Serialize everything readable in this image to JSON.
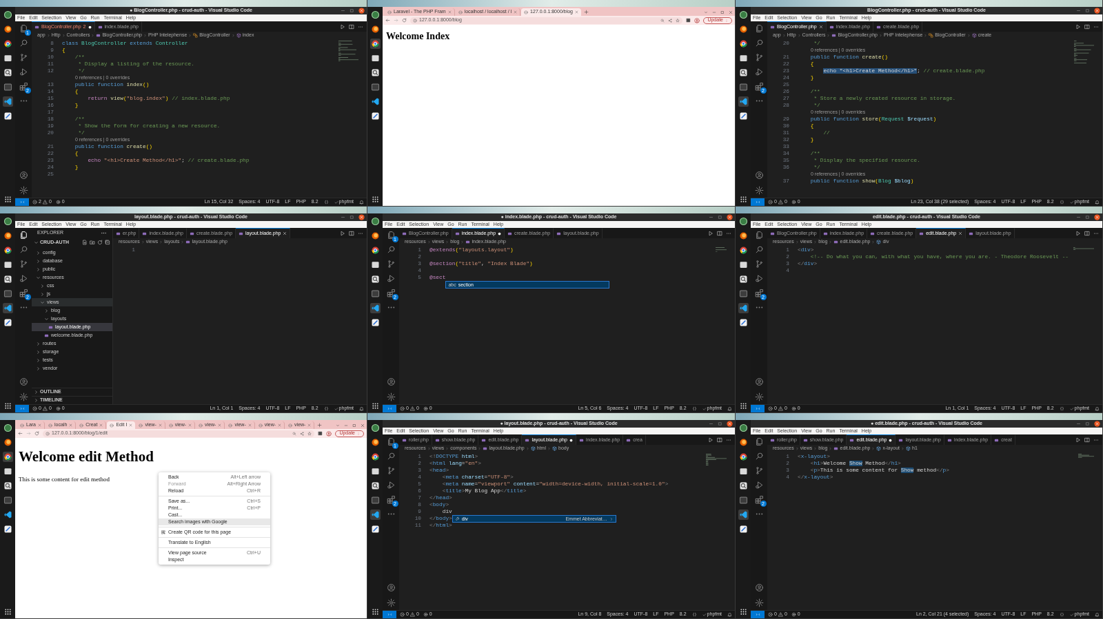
{
  "panels": [
    {
      "kind": "vscode",
      "title": "● BlogController.php - crud-auth - Visual Studio Code",
      "menu": [
        "File",
        "Edit",
        "Selection",
        "View",
        "Go",
        "Run",
        "Terminal",
        "Help"
      ],
      "badges": {
        "files": "1",
        "extensions": "2"
      },
      "tabs": [
        {
          "label": "BlogController.php",
          "problems": "2",
          "selected": true,
          "modified": true
        },
        {
          "label": "index.blade.php",
          "selected": false,
          "modified": false
        }
      ],
      "breadcrumb": [
        {
          "text": "app",
          "kind": "folder"
        },
        {
          "text": "Http",
          "kind": "folder"
        },
        {
          "text": "Controllers",
          "kind": "folder"
        },
        {
          "text": "BlogController.php",
          "kind": "file"
        },
        {
          "text": "PHP Intelephense",
          "kind": "provider"
        },
        {
          "text": "BlogController",
          "kind": "class"
        },
        {
          "text": "index",
          "kind": "method"
        }
      ],
      "lines": [
        {
          "kind": "code",
          "num": "8",
          "tokens": [
            {
              "text": "class",
              "kind": "keyword"
            },
            {
              "text": " BlogController ",
              "kind": "type"
            },
            {
              "text": "extends",
              "kind": "keyword"
            },
            {
              "text": " Controller",
              "kind": "type"
            }
          ]
        },
        {
          "kind": "code",
          "num": "9",
          "tokens": [
            {
              "text": "{",
              "kind": "bracket"
            }
          ]
        },
        {
          "kind": "code",
          "num": "10",
          "tokens": [
            {
              "text": "    /**",
              "kind": "comment"
            }
          ]
        },
        {
          "kind": "code",
          "num": "11",
          "tokens": [
            {
              "text": "     * Display a listing of the resource.",
              "kind": "comment"
            }
          ]
        },
        {
          "kind": "code",
          "num": "12",
          "tokens": [
            {
              "text": "     */",
              "kind": "comment"
            }
          ]
        },
        {
          "kind": "lens",
          "text": "0 references | 0 overrides"
        },
        {
          "kind": "code",
          "num": "13",
          "tokens": [
            {
              "text": "    public function ",
              "kind": "keyword"
            },
            {
              "text": "index",
              "kind": "function"
            },
            {
              "text": "()",
              "kind": "bracket"
            }
          ]
        },
        {
          "kind": "code",
          "num": "14",
          "tokens": [
            {
              "text": "    {",
              "kind": "bracket"
            }
          ]
        },
        {
          "kind": "code",
          "num": "15",
          "tokens": [
            {
              "text": "        return",
              "kind": "control"
            },
            {
              "text": " view",
              "kind": "function"
            },
            {
              "text": "(",
              "kind": "bracket"
            },
            {
              "text": "\"blog.index\"",
              "kind": "string"
            },
            {
              "text": ")",
              "kind": "bracket"
            },
            {
              "text": " // index.blade.php",
              "kind": "comment"
            }
          ]
        },
        {
          "kind": "code",
          "num": "16",
          "tokens": [
            {
              "text": "    }",
              "kind": "bracket"
            }
          ]
        },
        {
          "kind": "code",
          "num": "17"
        },
        {
          "kind": "code",
          "num": "18",
          "tokens": [
            {
              "text": "    /**",
              "kind": "comment"
            }
          ]
        },
        {
          "kind": "code",
          "num": "19",
          "tokens": [
            {
              "text": "     * Show the form for creating a new resource.",
              "kind": "comment"
            }
          ]
        },
        {
          "kind": "code",
          "num": "20",
          "tokens": [
            {
              "text": "     */",
              "kind": "comment"
            }
          ]
        },
        {
          "kind": "lens",
          "text": "0 references | 0 overrides"
        },
        {
          "kind": "code",
          "num": "21",
          "tokens": [
            {
              "text": "    public function ",
              "kind": "keyword"
            },
            {
              "text": "create",
              "kind": "function"
            },
            {
              "text": "()",
              "kind": "bracket"
            }
          ]
        },
        {
          "kind": "code",
          "num": "22",
          "tokens": [
            {
              "text": "    {",
              "kind": "bracket"
            }
          ]
        },
        {
          "kind": "code",
          "num": "23",
          "tokens": [
            {
              "text": "        echo",
              "kind": "control"
            },
            {
              "text": " \"<h1>Create Method</h1>\"",
              "kind": "string"
            },
            {
              "text": ";",
              "kind": "plain"
            },
            {
              "text": " // create.blade.php",
              "kind": "comment"
            }
          ]
        },
        {
          "kind": "code",
          "num": "24",
          "tokens": [
            {
              "text": "    }",
              "kind": "bracket"
            }
          ]
        },
        {
          "kind": "code",
          "num": "25"
        }
      ],
      "status": {
        "errors": "2",
        "warnings": "0",
        "ports": "0",
        "items": [
          "Ln 15, Col 32",
          "Spaces: 4",
          "UTF-8",
          "LF",
          "PHP",
          "8.2",
          "phpfmt"
        ]
      }
    },
    {
      "kind": "browser",
      "tabs": [
        {
          "label": "Laravel - The PHP Fram",
          "selected": false
        },
        {
          "label": "localhost / localhost / l",
          "selected": false
        },
        {
          "label": "127.0.0.1:8000/blog",
          "selected": true
        }
      ],
      "address": "127.0.0.1:8000/blog",
      "update_button": "Update",
      "page": {
        "kind": "compact",
        "heading": "Welcome Index"
      }
    },
    {
      "kind": "vscode",
      "title": "BlogController.php - crud-auth - Visual Studio Code",
      "menu": [
        "File",
        "Edit",
        "Selection",
        "View",
        "Go",
        "Run",
        "Terminal",
        "Help"
      ],
      "badges": {
        "extensions": "2"
      },
      "tabs": [
        {
          "label": "BlogController.php",
          "selected": true,
          "modified": false
        },
        {
          "label": "index.blade.php",
          "selected": false,
          "modified": false
        },
        {
          "label": "create.blade.php",
          "selected": false,
          "modified": false
        }
      ],
      "breadcrumb": [
        {
          "text": "app",
          "kind": "folder"
        },
        {
          "text": "Http",
          "kind": "folder"
        },
        {
          "text": "Controllers",
          "kind": "folder"
        },
        {
          "text": "BlogController.php",
          "kind": "file"
        },
        {
          "text": "PHP Intelephense",
          "kind": "provider"
        },
        {
          "text": "BlogController",
          "kind": "class"
        },
        {
          "text": "create",
          "kind": "method"
        }
      ],
      "lines": [
        {
          "kind": "code",
          "num": "20",
          "tokens": [
            {
              "text": "     */",
              "kind": "comment"
            }
          ]
        },
        {
          "kind": "lens",
          "text": "0 references | 0 overrides"
        },
        {
          "kind": "code",
          "num": "21",
          "tokens": [
            {
              "text": "    public function ",
              "kind": "keyword"
            },
            {
              "text": "create",
              "kind": "function"
            },
            {
              "text": "()",
              "kind": "bracket"
            }
          ]
        },
        {
          "kind": "code",
          "num": "22",
          "tokens": [
            {
              "text": "    {",
              "kind": "bracket"
            }
          ]
        },
        {
          "kind": "code",
          "num": "23",
          "tokens": [
            {
              "text": "        echo \"<h1>Create Method</h1>\"",
              "kind": "selection"
            },
            {
              "text": ";",
              "kind": "plain"
            },
            {
              "text": " // create.blade.php",
              "kind": "comment"
            }
          ]
        },
        {
          "kind": "code",
          "num": "24",
          "tokens": [
            {
              "text": "    }",
              "kind": "bracket"
            }
          ]
        },
        {
          "kind": "code",
          "num": "25"
        },
        {
          "kind": "code",
          "num": "26",
          "tokens": [
            {
              "text": "    /**",
              "kind": "comment"
            }
          ]
        },
        {
          "kind": "code",
          "num": "27",
          "tokens": [
            {
              "text": "     * Store a newly created resource in storage.",
              "kind": "comment"
            }
          ]
        },
        {
          "kind": "code",
          "num": "28",
          "tokens": [
            {
              "text": "     */",
              "kind": "comment"
            }
          ]
        },
        {
          "kind": "lens",
          "text": "0 references | 0 overrides"
        },
        {
          "kind": "code",
          "num": "29",
          "tokens": [
            {
              "text": "    public function ",
              "kind": "keyword"
            },
            {
              "text": "store",
              "kind": "function"
            },
            {
              "text": "(",
              "kind": "bracket"
            },
            {
              "text": "Request",
              "kind": "type"
            },
            {
              "text": " $request",
              "kind": "variable"
            },
            {
              "text": ")",
              "kind": "bracket"
            }
          ]
        },
        {
          "kind": "code",
          "num": "30",
          "tokens": [
            {
              "text": "    {",
              "kind": "bracket"
            }
          ]
        },
        {
          "kind": "code",
          "num": "31",
          "tokens": [
            {
              "text": "        //",
              "kind": "comment"
            }
          ]
        },
        {
          "kind": "code",
          "num": "32",
          "tokens": [
            {
              "text": "    }",
              "kind": "bracket"
            }
          ]
        },
        {
          "kind": "code",
          "num": "33"
        },
        {
          "kind": "code",
          "num": "34",
          "tokens": [
            {
              "text": "    /**",
              "kind": "comment"
            }
          ]
        },
        {
          "kind": "code",
          "num": "35",
          "tokens": [
            {
              "text": "     * Display the specified resource.",
              "kind": "comment"
            }
          ]
        },
        {
          "kind": "code",
          "num": "36",
          "tokens": [
            {
              "text": "     */",
              "kind": "comment"
            }
          ]
        },
        {
          "kind": "lens",
          "text": "0 references | 0 overrides"
        },
        {
          "kind": "code",
          "num": "37",
          "tokens": [
            {
              "text": "    public function ",
              "kind": "keyword"
            },
            {
              "text": "show",
              "kind": "function"
            },
            {
              "text": "(",
              "kind": "bracket"
            },
            {
              "text": "Blog",
              "kind": "type"
            },
            {
              "text": " $blog",
              "kind": "variable"
            },
            {
              "text": ")",
              "kind": "bracket"
            }
          ]
        }
      ],
      "status": {
        "errors": "0",
        "warnings": "0",
        "ports": "0",
        "items": [
          "Ln 23, Col 38 (29 selected)",
          "Spaces: 4",
          "UTF-8",
          "LF",
          "PHP",
          "8.2",
          "phpfmt"
        ]
      }
    },
    {
      "kind": "vscode",
      "title": "layout.blade.php - crud-auth - Visual Studio Code",
      "menu": [
        "File",
        "Edit",
        "Selection",
        "View",
        "Go",
        "Run",
        "Terminal",
        "Help"
      ],
      "badges": {
        "extensions": "2"
      },
      "sidebar": {
        "title": "EXPLORER",
        "root": "CRUD-AUTH",
        "tree": [
          {
            "label": "config",
            "kind": "folder",
            "expanded": false,
            "selected": false,
            "hovered": false
          },
          {
            "label": "database",
            "kind": "folder",
            "expanded": false,
            "selected": false,
            "hovered": false
          },
          {
            "label": "public",
            "kind": "folder",
            "expanded": false,
            "selected": false,
            "hovered": false
          },
          {
            "label": "resources",
            "kind": "folder",
            "expanded": true,
            "selected": false,
            "hovered": false,
            "children": [
              {
                "label": "css",
                "kind": "folder",
                "expanded": false,
                "selected": false,
                "hovered": false
              },
              {
                "label": "js",
                "kind": "folder",
                "expanded": false,
                "selected": false,
                "hovered": false
              },
              {
                "label": "views",
                "kind": "folder",
                "expanded": true,
                "selected": false,
                "hovered": true,
                "children": [
                  {
                    "label": "blog",
                    "kind": "folder",
                    "expanded": false,
                    "selected": false,
                    "hovered": false
                  },
                  {
                    "label": "layouts",
                    "kind": "folder",
                    "expanded": true,
                    "selected": false,
                    "hovered": false,
                    "children": [
                      {
                        "label": "layout.blade.php",
                        "kind": "file",
                        "selected": true,
                        "hovered": false
                      }
                    ]
                  },
                  {
                    "label": "welcome.blade.php",
                    "kind": "file",
                    "selected": false,
                    "hovered": false
                  }
                ]
              }
            ]
          },
          {
            "label": "routes",
            "kind": "folder",
            "expanded": false,
            "selected": false,
            "hovered": false
          },
          {
            "label": "storage",
            "kind": "folder",
            "expanded": false,
            "selected": false,
            "hovered": false
          },
          {
            "label": "tests",
            "kind": "folder",
            "expanded": false,
            "selected": false,
            "hovered": false
          },
          {
            "label": "vendor",
            "kind": "folder",
            "expanded": false,
            "selected": false,
            "hovered": false
          }
        ],
        "sections": [
          "OUTLINE",
          "TIMELINE"
        ]
      },
      "tabs": [
        {
          "label": "er.php",
          "selected": false,
          "modified": false
        },
        {
          "label": "index.blade.php",
          "selected": false,
          "modified": false
        },
        {
          "label": "create.blade.php",
          "selected": false,
          "modified": false
        },
        {
          "label": "layout.blade.php",
          "selected": true,
          "modified": false
        }
      ],
      "breadcrumb": [
        {
          "text": "resources",
          "kind": "folder"
        },
        {
          "text": "views",
          "kind": "folder"
        },
        {
          "text": "layouts",
          "kind": "folder"
        },
        {
          "text": "layout.blade.php",
          "kind": "file"
        }
      ],
      "lines": [
        {
          "kind": "code",
          "num": "1"
        }
      ],
      "status": {
        "errors": "0",
        "warnings": "0",
        "ports": "0",
        "items": [
          "Ln 1, Col 1",
          "Spaces: 4",
          "UTF-8",
          "LF",
          "PHP",
          "8.2",
          "phpfmt"
        ]
      }
    },
    {
      "kind": "vscode",
      "title": "● index.blade.php - crud-auth - Visual Studio Code",
      "menu": [
        "File",
        "Edit",
        "Selection",
        "View",
        "Go",
        "Run",
        "Terminal",
        "Help"
      ],
      "badges": {
        "files": "1",
        "extensions": "2"
      },
      "tabs": [
        {
          "label": "BlogController.php",
          "selected": false,
          "modified": false
        },
        {
          "label": "index.blade.php",
          "selected": true,
          "modified": true
        },
        {
          "label": "create.blade.php",
          "selected": false,
          "modified": false
        },
        {
          "label": "layout.blade.php",
          "selected": false,
          "modified": false
        }
      ],
      "breadcrumb": [
        {
          "text": "resources",
          "kind": "folder"
        },
        {
          "text": "views",
          "kind": "folder"
        },
        {
          "text": "blog",
          "kind": "folder"
        },
        {
          "text": "index.blade.php",
          "kind": "file"
        }
      ],
      "lines": [
        {
          "kind": "code",
          "num": "1",
          "tokens": [
            {
              "text": "@extends",
              "kind": "directive"
            },
            {
              "text": "(",
              "kind": "bracket"
            },
            {
              "text": "\"layouts.layout\"",
              "kind": "string"
            },
            {
              "text": ")",
              "kind": "bracket"
            }
          ]
        },
        {
          "kind": "code",
          "num": "2"
        },
        {
          "kind": "code",
          "num": "3",
          "tokens": [
            {
              "text": "@section",
              "kind": "directive"
            },
            {
              "text": "(",
              "kind": "bracket"
            },
            {
              "text": "\"title\"",
              "kind": "string"
            },
            {
              "text": ", ",
              "kind": "plain"
            },
            {
              "text": "\"Index Blade\"",
              "kind": "string"
            },
            {
              "text": ")",
              "kind": "bracket"
            }
          ]
        },
        {
          "kind": "code",
          "num": "4"
        },
        {
          "kind": "code",
          "num": "5",
          "tokens": [
            {
              "text": "@sect",
              "kind": "directive"
            }
          ],
          "suggest": {
            "kind": "word",
            "glyph": "abc",
            "label": "section"
          }
        }
      ],
      "status": {
        "errors": "0",
        "warnings": "0",
        "ports": "0",
        "items": [
          "Ln 5, Col 6",
          "Spaces: 4",
          "UTF-8",
          "LF",
          "PHP",
          "8.2",
          "phpfmt"
        ]
      }
    },
    {
      "kind": "vscode",
      "title": "edit.blade.php - crud-auth - Visual Studio Code",
      "menu": [
        "File",
        "Edit",
        "Selection",
        "View",
        "Go",
        "Run",
        "Terminal",
        "Help"
      ],
      "badges": {
        "extensions": "2"
      },
      "tabs": [
        {
          "label": "BlogController.php",
          "selected": false,
          "modified": false
        },
        {
          "label": "index.blade.php",
          "selected": false,
          "modified": false
        },
        {
          "label": "create.blade.php",
          "selected": false,
          "modified": false
        },
        {
          "label": "edit.blade.php",
          "selected": true,
          "modified": false
        },
        {
          "label": "layout.blade.php",
          "selected": false,
          "modified": false
        }
      ],
      "breadcrumb": [
        {
          "text": "resources",
          "kind": "folder"
        },
        {
          "text": "views",
          "kind": "folder"
        },
        {
          "text": "blog",
          "kind": "folder"
        },
        {
          "text": "edit.blade.php",
          "kind": "file"
        },
        {
          "text": "div",
          "kind": "element"
        }
      ],
      "lines": [
        {
          "kind": "code",
          "num": "1",
          "tokens": [
            {
              "text": "<",
              "kind": "punct"
            },
            {
              "text": "div",
              "kind": "tag"
            },
            {
              "text": ">",
              "kind": "punct"
            }
          ]
        },
        {
          "kind": "code",
          "num": "2",
          "tokens": [
            {
              "text": "    <!-- Do what you can, with what you have, where you are. - Theodore Roosevelt --",
              "kind": "comment"
            }
          ]
        },
        {
          "kind": "code",
          "num": "3",
          "tokens": [
            {
              "text": "</",
              "kind": "punct"
            },
            {
              "text": "div",
              "kind": "tag"
            },
            {
              "text": ">",
              "kind": "punct"
            }
          ]
        },
        {
          "kind": "code",
          "num": "4"
        }
      ],
      "status": {
        "errors": "0",
        "warnings": "0",
        "ports": "0",
        "items": [
          "Ln 1, Col 1",
          "Spaces: 4",
          "UTF-8",
          "LF",
          "PHP",
          "8.2",
          "phpfmt"
        ]
      }
    },
    {
      "kind": "browser",
      "tabs": [
        {
          "label": "Lara",
          "selected": false
        },
        {
          "label": "localh",
          "selected": false
        },
        {
          "label": "Creat",
          "selected": false
        },
        {
          "label": "Edit I",
          "selected": true
        },
        {
          "label": "view-",
          "selected": false
        },
        {
          "label": "view-",
          "selected": false
        },
        {
          "label": "view-",
          "selected": false
        },
        {
          "label": "view-",
          "selected": false
        },
        {
          "label": "view-",
          "selected": false
        },
        {
          "label": "view-",
          "selected": false
        }
      ],
      "address": "127.0.0.1:8000/blog/1/edit",
      "update_button": "Update",
      "page": {
        "kind": "spacious",
        "heading": "Welcome edit Method",
        "paragraph": "This is some content for edit method"
      },
      "context_menu": [
        [
          {
            "kind": "command",
            "label": "Back",
            "shortcut": "Alt+Left arrow",
            "disabled": false,
            "highlighted": false
          },
          {
            "kind": "command",
            "label": "Forward",
            "shortcut": "Alt+Right Arrow",
            "disabled": true,
            "highlighted": false
          },
          {
            "kind": "command",
            "label": "Reload",
            "shortcut": "Ctrl+R",
            "disabled": false,
            "highlighted": false
          }
        ],
        [
          {
            "kind": "command",
            "label": "Save as...",
            "shortcut": "Ctrl+S",
            "disabled": false,
            "highlighted": false
          },
          {
            "kind": "command",
            "label": "Print...",
            "shortcut": "Ctrl+P",
            "disabled": false,
            "highlighted": false
          },
          {
            "kind": "command",
            "label": "Cast...",
            "disabled": false,
            "highlighted": false
          },
          {
            "kind": "command",
            "label": "Search images with Google",
            "disabled": false,
            "highlighted": true
          }
        ],
        [
          {
            "kind": "qr",
            "label": "Create QR code for this page",
            "disabled": false,
            "highlighted": false
          }
        ],
        [
          {
            "kind": "command",
            "label": "Translate to English",
            "disabled": false,
            "highlighted": false
          }
        ],
        [
          {
            "kind": "command",
            "label": "View page source",
            "shortcut": "Ctrl+U",
            "disabled": false,
            "highlighted": false
          },
          {
            "kind": "command",
            "label": "Inspect",
            "disabled": false,
            "highlighted": false
          }
        ]
      ]
    },
    {
      "kind": "vscode",
      "title": "● layout.blade.php - crud-auth - Visual Studio Code",
      "menu": [
        "File",
        "Edit",
        "Selection",
        "View",
        "Go",
        "Run",
        "Terminal",
        "Help"
      ],
      "badges": {
        "files": "1",
        "extensions": "2"
      },
      "tabs": [
        {
          "label": "roller.php",
          "selected": false,
          "modified": false
        },
        {
          "label": "show.blade.php",
          "selected": false,
          "modified": false
        },
        {
          "label": "edit.blade.php",
          "selected": false,
          "modified": false
        },
        {
          "label": "layout.blade.php",
          "selected": true,
          "modified": true
        },
        {
          "label": "index.blade.php",
          "selected": false,
          "modified": false
        },
        {
          "label": "crea",
          "selected": false,
          "modified": false
        }
      ],
      "breadcrumb": [
        {
          "text": "resources",
          "kind": "folder"
        },
        {
          "text": "views",
          "kind": "folder"
        },
        {
          "text": "components",
          "kind": "folder"
        },
        {
          "text": "layout.blade.php",
          "kind": "file"
        },
        {
          "text": "html",
          "kind": "element"
        },
        {
          "text": "body",
          "kind": "element"
        }
      ],
      "lines": [
        {
          "kind": "code",
          "num": "1",
          "tokens": [
            {
              "text": "<!",
              "kind": "punct"
            },
            {
              "text": "DOCTYPE",
              "kind": "tag"
            },
            {
              "text": " html",
              "kind": "attr"
            },
            {
              "text": ">",
              "kind": "punct"
            }
          ]
        },
        {
          "kind": "code",
          "num": "2",
          "tokens": [
            {
              "text": "<",
              "kind": "punct"
            },
            {
              "text": "html",
              "kind": "tag"
            },
            {
              "text": " lang",
              "kind": "attr"
            },
            {
              "text": "=",
              "kind": "plain"
            },
            {
              "text": "\"en\"",
              "kind": "string"
            },
            {
              "text": ">",
              "kind": "punct"
            }
          ]
        },
        {
          "kind": "code",
          "num": "3",
          "tokens": [
            {
              "text": "<",
              "kind": "punct"
            },
            {
              "text": "head",
              "kind": "tag"
            },
            {
              "text": ">",
              "kind": "punct"
            }
          ]
        },
        {
          "kind": "code",
          "num": "4",
          "tokens": [
            {
              "text": "    <",
              "kind": "punct"
            },
            {
              "text": "meta",
              "kind": "tag"
            },
            {
              "text": " charset",
              "kind": "attr"
            },
            {
              "text": "=",
              "kind": "plain"
            },
            {
              "text": "\"UTF-8\"",
              "kind": "string"
            },
            {
              "text": ">",
              "kind": "punct"
            }
          ]
        },
        {
          "kind": "code",
          "num": "5",
          "tokens": [
            {
              "text": "    <",
              "kind": "punct"
            },
            {
              "text": "meta",
              "kind": "tag"
            },
            {
              "text": " name",
              "kind": "attr"
            },
            {
              "text": "=",
              "kind": "plain"
            },
            {
              "text": "\"viewport\"",
              "kind": "string"
            },
            {
              "text": " content",
              "kind": "attr"
            },
            {
              "text": "=",
              "kind": "plain"
            },
            {
              "text": "\"width=device-width, initial-scale=1.0\"",
              "kind": "string"
            },
            {
              "text": ">",
              "kind": "punct"
            }
          ]
        },
        {
          "kind": "code",
          "num": "6",
          "tokens": [
            {
              "text": "    <",
              "kind": "punct"
            },
            {
              "text": "title",
              "kind": "tag"
            },
            {
              "text": ">",
              "kind": "punct"
            },
            {
              "text": "My Blog App",
              "kind": "plain"
            },
            {
              "text": "</",
              "kind": "punct"
            },
            {
              "text": "title",
              "kind": "tag"
            },
            {
              "text": ">",
              "kind": "punct"
            }
          ]
        },
        {
          "kind": "code",
          "num": "7",
          "tokens": [
            {
              "text": "</",
              "kind": "punct"
            },
            {
              "text": "head",
              "kind": "tag"
            },
            {
              "text": ">",
              "kind": "punct"
            }
          ]
        },
        {
          "kind": "code",
          "num": "8",
          "tokens": [
            {
              "text": "<",
              "kind": "punct"
            },
            {
              "text": "body",
              "kind": "tag"
            },
            {
              "text": ">",
              "kind": "punct"
            }
          ]
        },
        {
          "kind": "code",
          "num": "9",
          "tokens": [
            {
              "text": "    div",
              "kind": "plain"
            }
          ],
          "suggest": {
            "kind": "emmet",
            "label": "div",
            "detail": "Emmet Abbreviat…"
          }
        },
        {
          "kind": "code",
          "num": "10",
          "tokens": [
            {
              "text": "</",
              "kind": "punct"
            },
            {
              "text": "body",
              "kind": "tag"
            },
            {
              "text": ">",
              "kind": "punct"
            }
          ]
        },
        {
          "kind": "code",
          "num": "11",
          "tokens": [
            {
              "text": "</",
              "kind": "punct"
            },
            {
              "text": "html",
              "kind": "tag"
            },
            {
              "text": ">",
              "kind": "punct"
            }
          ]
        }
      ],
      "status": {
        "errors": "0",
        "warnings": "0",
        "ports": "0",
        "items": [
          "Ln 9, Col 8",
          "Spaces: 4",
          "UTF-8",
          "LF",
          "PHP",
          "8.2",
          "phpfmt"
        ]
      }
    },
    {
      "kind": "vscode",
      "title": "● edit.blade.php - crud-auth - Visual Studio Code",
      "menu": [
        "File",
        "Edit",
        "Selection",
        "View",
        "Go",
        "Run",
        "Terminal",
        "Help"
      ],
      "badges": {
        "extensions": "2"
      },
      "tabs": [
        {
          "label": "roller.php",
          "selected": false,
          "modified": false
        },
        {
          "label": "show.blade.php",
          "selected": false,
          "modified": false
        },
        {
          "label": "edit.blade.php",
          "selected": true,
          "modified": true
        },
        {
          "label": "layout.blade.php",
          "selected": false,
          "modified": false
        },
        {
          "label": "index.blade.php",
          "selected": false,
          "modified": false
        },
        {
          "label": "creat",
          "selected": false,
          "modified": false
        }
      ],
      "breadcrumb": [
        {
          "text": "resources",
          "kind": "folder"
        },
        {
          "text": "views",
          "kind": "folder"
        },
        {
          "text": "blog",
          "kind": "folder"
        },
        {
          "text": "edit.blade.php",
          "kind": "file"
        },
        {
          "text": "x-layout",
          "kind": "element"
        },
        {
          "text": "h1",
          "kind": "element"
        }
      ],
      "lines": [
        {
          "kind": "code",
          "num": "1",
          "tokens": [
            {
              "text": "<",
              "kind": "punct"
            },
            {
              "text": "x-layout",
              "kind": "tag"
            },
            {
              "text": ">",
              "kind": "punct"
            }
          ]
        },
        {
          "kind": "code",
          "num": "2",
          "tokens": [
            {
              "text": "    <",
              "kind": "punct"
            },
            {
              "text": "h1",
              "kind": "tag"
            },
            {
              "text": ">",
              "kind": "punct"
            },
            {
              "text": "Welcome ",
              "kind": "plain"
            },
            {
              "text": "Show",
              "kind": "highlight"
            },
            {
              "text": " Method",
              "kind": "plain"
            },
            {
              "text": "</",
              "kind": "punct"
            },
            {
              "text": "h1",
              "kind": "tag"
            },
            {
              "text": ">",
              "kind": "punct"
            }
          ]
        },
        {
          "kind": "code",
          "num": "3",
          "tokens": [
            {
              "text": "    <",
              "kind": "punct"
            },
            {
              "text": "p",
              "kind": "tag"
            },
            {
              "text": ">",
              "kind": "punct"
            },
            {
              "text": "This is some content for ",
              "kind": "plain"
            },
            {
              "text": "Show",
              "kind": "highlight"
            },
            {
              "text": " method",
              "kind": "plain"
            },
            {
              "text": "</",
              "kind": "punct"
            },
            {
              "text": "p",
              "kind": "tag"
            },
            {
              "text": ">",
              "kind": "punct"
            }
          ]
        },
        {
          "kind": "code",
          "num": "4",
          "tokens": [
            {
              "text": "</",
              "kind": "punct"
            },
            {
              "text": "x-layout",
              "kind": "tag"
            },
            {
              "text": ">",
              "kind": "punct"
            }
          ]
        }
      ],
      "status": {
        "errors": "0",
        "warnings": "0",
        "ports": "0",
        "items": [
          "Ln 2, Col 21 (4 selected)",
          "Spaces: 4",
          "UTF-8",
          "LF",
          "PHP",
          "8.2",
          "phpfmt"
        ]
      }
    }
  ]
}
